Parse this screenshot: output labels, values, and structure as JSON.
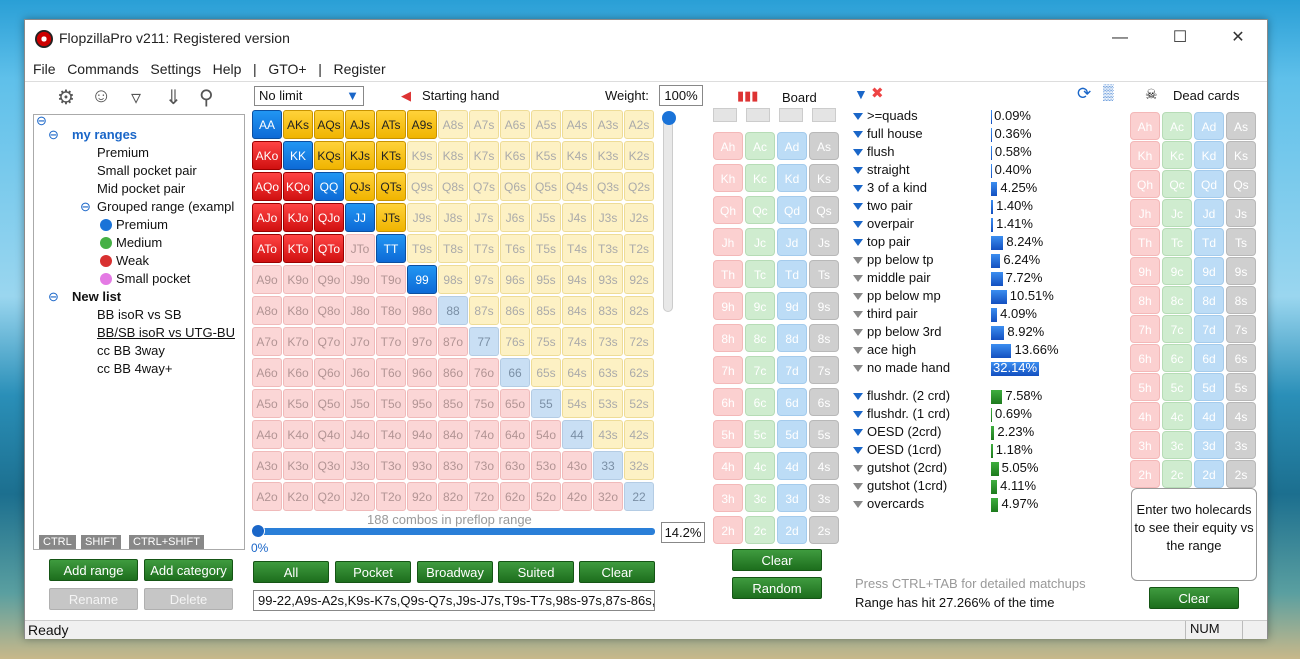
{
  "window": {
    "title": "FlopzillaPro v211: Registered version"
  },
  "menu": [
    "File",
    "Commands",
    "Settings",
    "Help",
    "|",
    "GTO+",
    "|",
    "Register"
  ],
  "tree": {
    "root1": "my ranges",
    "items1": [
      "Premium",
      "Small pocket pair",
      "Mid pocket pair",
      "Grouped range (exampl"
    ],
    "grouped": [
      {
        "label": "Premium",
        "color": "#1a73d8"
      },
      {
        "label": "Medium",
        "color": "#45b045"
      },
      {
        "label": "Weak",
        "color": "#d83030"
      },
      {
        "label": "Small pocket",
        "color": "#e47ae4"
      }
    ],
    "root2": "New list",
    "items2": [
      "BB isoR vs SB",
      "BB/SB isoR vs UTG-BU",
      "cc BB 3way",
      "cc BB 4way+"
    ]
  },
  "modifiers": [
    "CTRL",
    "SHIFT",
    "CTRL+SHIFT"
  ],
  "left_buttons": {
    "add_range": "Add range",
    "add_category": "Add category",
    "rename": "Rename",
    "delete": "Delete"
  },
  "range": {
    "limit": "No limit",
    "starting_hand": "Starting hand",
    "weight_label": "Weight:",
    "weight": "100%",
    "combos": "188 combos in preflop range",
    "slider_value": "0%",
    "percent": "14.2%",
    "text": "99-22,A9s-A2s,K9s-K7s,Q9s-Q7s,J9s-J7s,T9s-T7s,98s-97s,87s-86s,7"
  },
  "grid_buttons": [
    "All",
    "Pocket",
    "Broadway",
    "Suited",
    "Clear"
  ],
  "board": {
    "label": "Board",
    "clear": "Clear",
    "random": "Random"
  },
  "stats": [
    {
      "label": ">=quads",
      "value": "0.09%",
      "pct": 0.09,
      "f": "b"
    },
    {
      "label": "full house",
      "value": "0.36%",
      "pct": 0.36,
      "f": "b"
    },
    {
      "label": "flush",
      "value": "0.58%",
      "pct": 0.58,
      "f": "b"
    },
    {
      "label": "straight",
      "value": "0.40%",
      "pct": 0.4,
      "f": "b"
    },
    {
      "label": "3 of a kind",
      "value": "4.25%",
      "pct": 4.25,
      "f": "b"
    },
    {
      "label": "two pair",
      "value": "1.40%",
      "pct": 1.4,
      "f": "b"
    },
    {
      "label": "overpair",
      "value": "1.41%",
      "pct": 1.41,
      "f": "b"
    },
    {
      "label": "top pair",
      "value": "8.24%",
      "pct": 8.24,
      "f": "b"
    },
    {
      "label": "pp below tp",
      "value": "6.24%",
      "pct": 6.24,
      "f": "g"
    },
    {
      "label": "middle pair",
      "value": "7.72%",
      "pct": 7.72,
      "f": "g"
    },
    {
      "label": "pp below mp",
      "value": "10.51%",
      "pct": 10.51,
      "f": "g"
    },
    {
      "label": "third pair",
      "value": "4.09%",
      "pct": 4.09,
      "f": "g"
    },
    {
      "label": "pp below 3rd",
      "value": "8.92%",
      "pct": 8.92,
      "f": "g"
    },
    {
      "label": "ace high",
      "value": "13.66%",
      "pct": 13.66,
      "f": "g"
    },
    {
      "label": "no made hand",
      "value": "32.14%",
      "pct": 32.14,
      "f": "g"
    }
  ],
  "draws": [
    {
      "label": "flushdr. (2 crd)",
      "value": "7.58%",
      "pct": 7.58,
      "f": "b"
    },
    {
      "label": "flushdr. (1 crd)",
      "value": "0.69%",
      "pct": 0.69,
      "f": "b"
    },
    {
      "label": "OESD (2crd)",
      "value": "2.23%",
      "pct": 2.23,
      "f": "b"
    },
    {
      "label": "OESD (1crd)",
      "value": "1.18%",
      "pct": 1.18,
      "f": "b"
    },
    {
      "label": "gutshot (2crd)",
      "value": "5.05%",
      "pct": 5.05,
      "f": "g"
    },
    {
      "label": "gutshot (1crd)",
      "value": "4.11%",
      "pct": 4.11,
      "f": "g"
    },
    {
      "label": "overcards",
      "value": "4.97%",
      "pct": 4.97,
      "f": "g"
    }
  ],
  "hint": "Press CTRL+TAB for detailed matchups",
  "hit": "Range has hit 27.266% of the time",
  "dead": {
    "label": "Dead cards",
    "equity": "Enter two holecards to see their equity vs the range",
    "clear": "Clear"
  },
  "status": {
    "left": "Ready",
    "right": "NUM"
  },
  "ranks": [
    "A",
    "K",
    "Q",
    "J",
    "T",
    "9",
    "8",
    "7",
    "6",
    "5",
    "4",
    "3",
    "2"
  ],
  "selected": [
    "AA",
    "KK",
    "QQ",
    "JJ",
    "TT",
    "99",
    "AKs",
    "AQs",
    "AJs",
    "ATs",
    "A9s",
    "KQs",
    "KJs",
    "KTs",
    "QJs",
    "QTs",
    "JTs",
    "AKo",
    "AQo",
    "AJo",
    "ATo",
    "KQo",
    "KJo",
    "KTo",
    "QJo",
    "QTo"
  ]
}
